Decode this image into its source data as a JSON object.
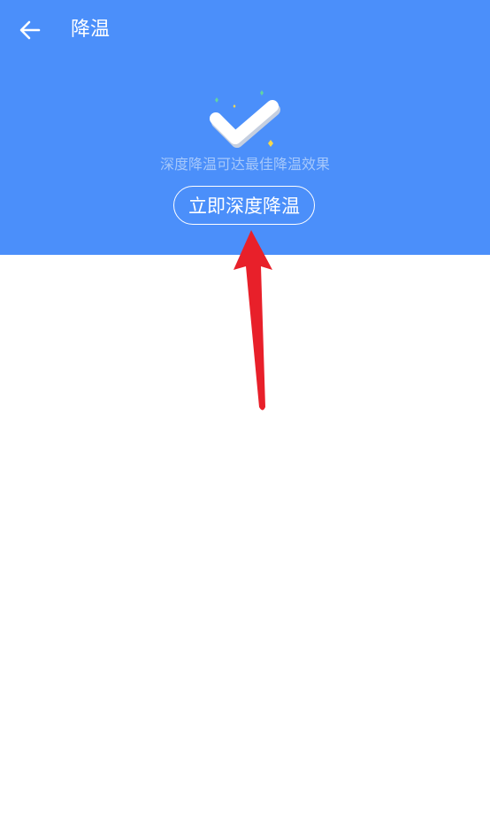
{
  "header": {
    "title": "降温",
    "back_icon": "arrow-left-icon",
    "background_color": "#4b8ffa"
  },
  "status": {
    "icon": "checkmark-icon",
    "message": "深度降温可达最佳降温效果"
  },
  "action": {
    "button_label": "立即深度降温"
  },
  "annotation": {
    "icon": "red-arrow-icon",
    "color": "#e8202a"
  }
}
